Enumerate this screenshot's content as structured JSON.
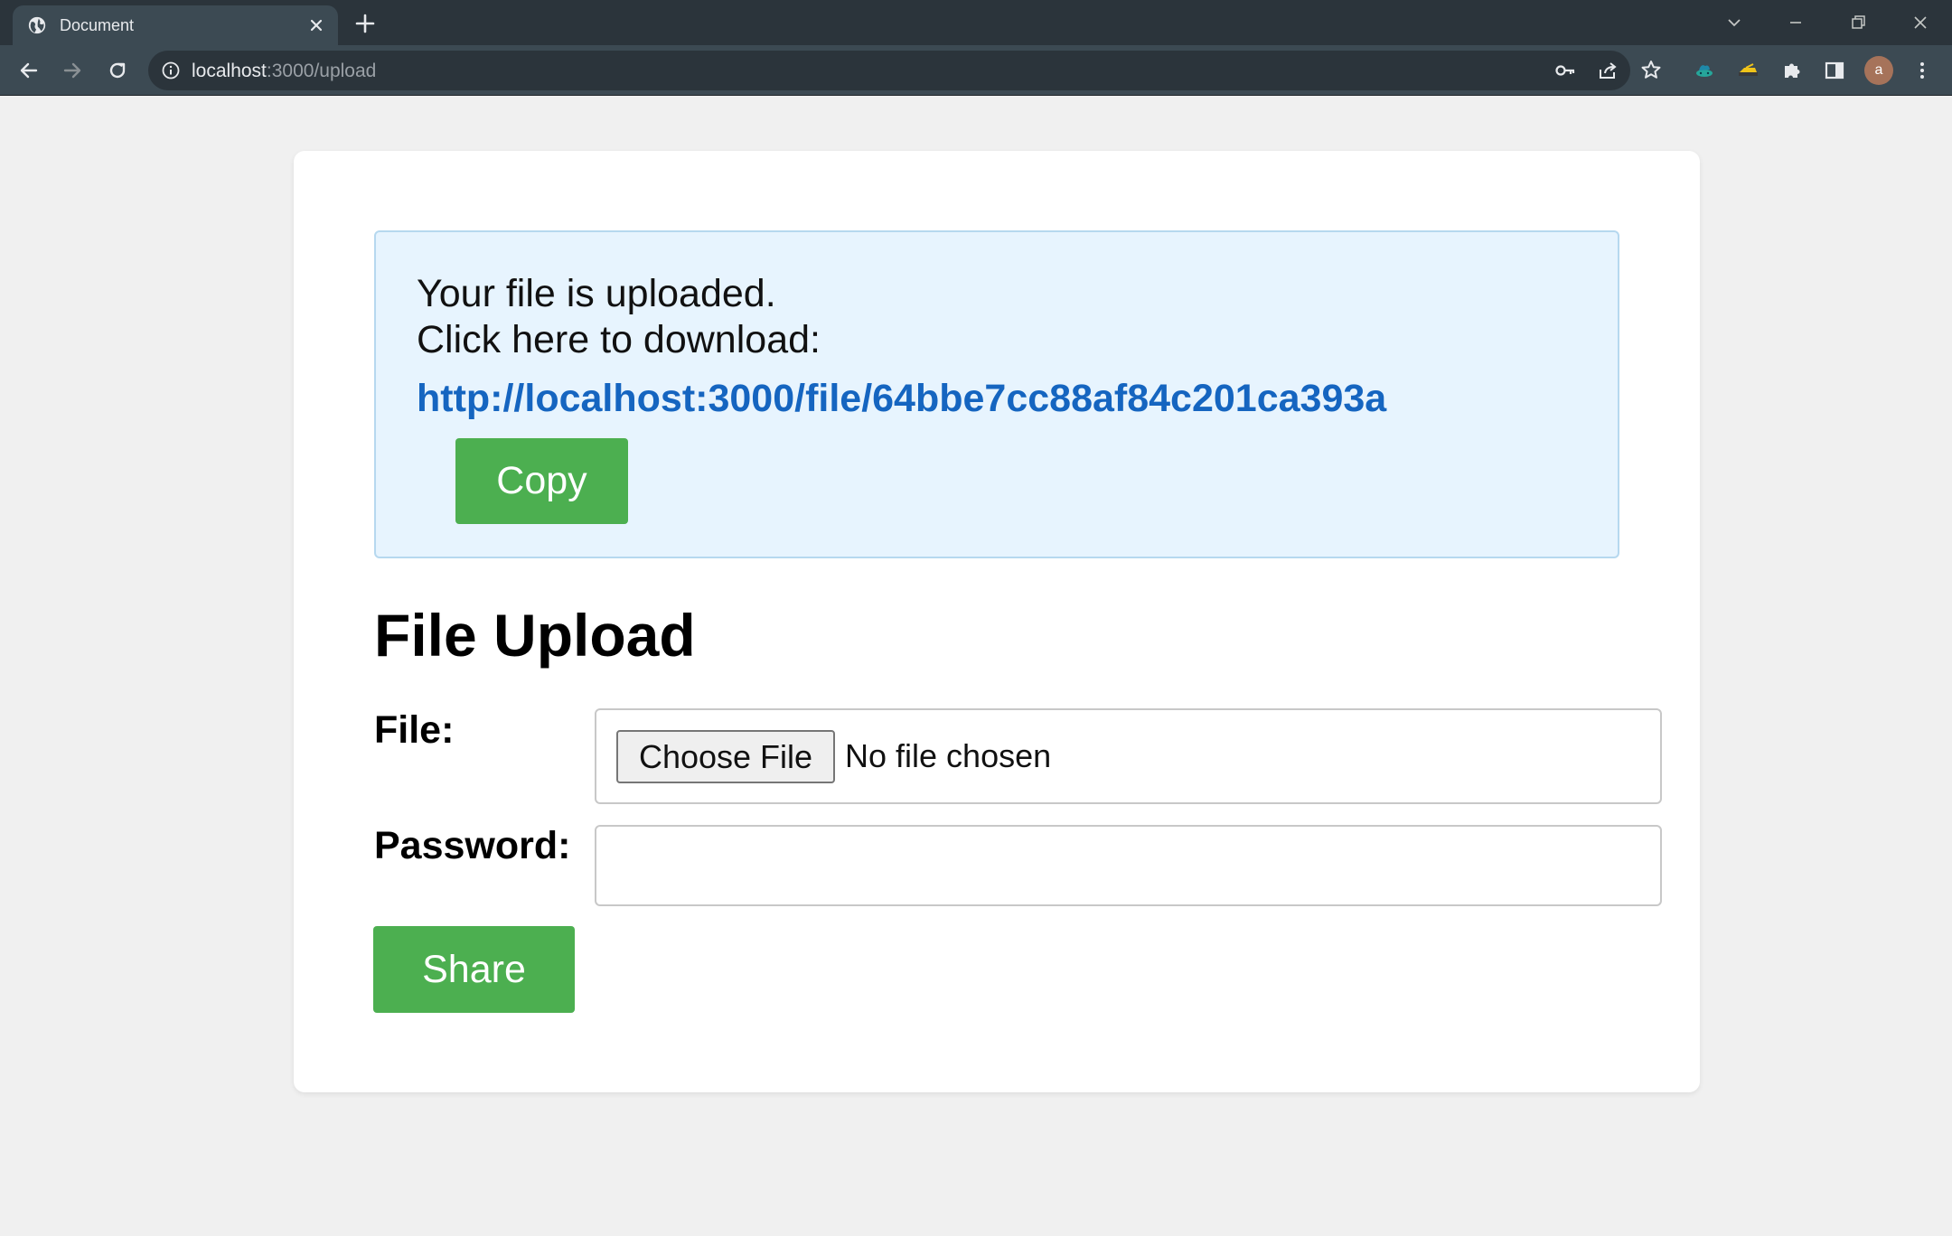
{
  "browser": {
    "tab_title": "Document",
    "url_host": "localhost",
    "url_rest": ":3000/upload",
    "avatar_letter": "a"
  },
  "notice": {
    "line1": "Your file is uploaded.",
    "line2": "Click here to download:",
    "link": "http://localhost:3000/file/64bbe7cc88af84c201ca393a",
    "copy_label": "Copy"
  },
  "form": {
    "heading": "File Upload",
    "file_label": "File:",
    "choose_label": "Choose File",
    "file_status": "No file chosen",
    "password_label": "Password:",
    "password_value": "",
    "share_label": "Share"
  },
  "colors": {
    "accent_green": "#4caf50",
    "link_blue": "#1565c0",
    "notice_bg": "#e7f4fe"
  }
}
